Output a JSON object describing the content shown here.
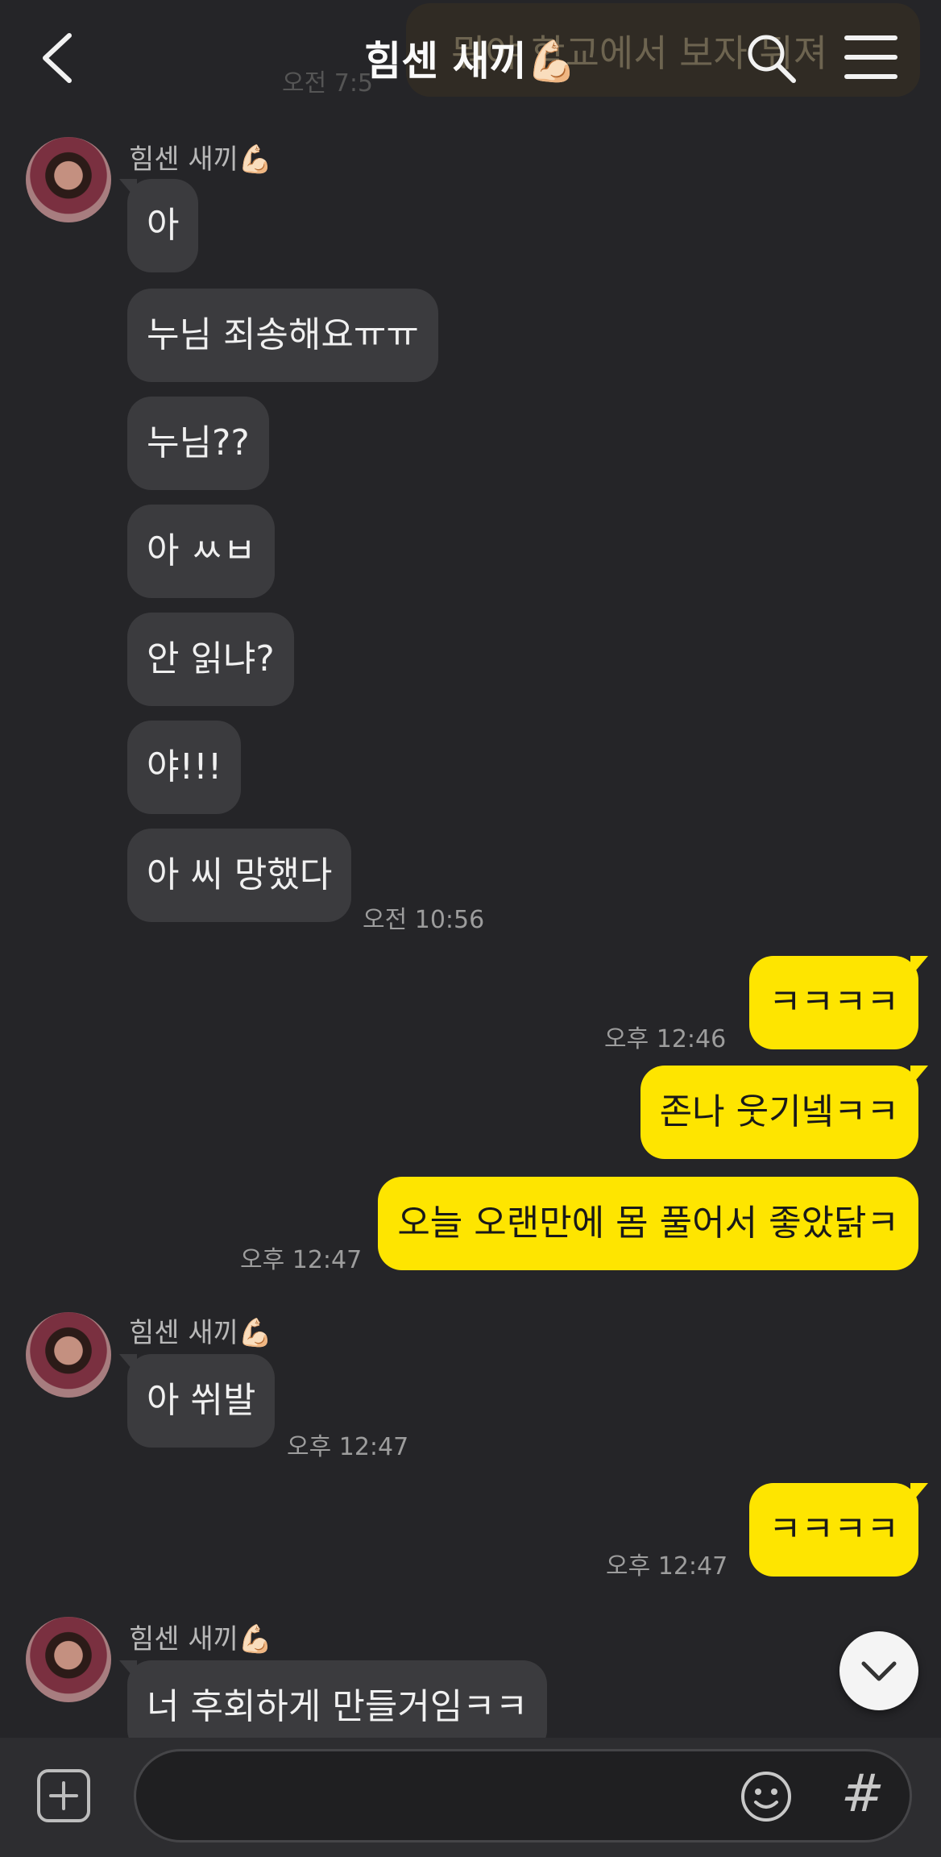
{
  "header": {
    "title": "힘센 새끼💪🏻",
    "ghost_message": "뭐야 학교에서 보자 뒤져",
    "ghost_time": "오전 7:5"
  },
  "messages": {
    "group1": {
      "sender": "힘센 새끼💪🏻",
      "bubbles": [
        "아",
        "누님 죄송해요ㅠㅠ",
        "누님??",
        "아 ㅆㅂ",
        "안 읽냐?",
        "야!!!",
        "아 씨 망했다"
      ],
      "time": "오전 10:56"
    },
    "sent1": {
      "text": "ㅋㅋㅋㅋ",
      "time": "오후 12:46"
    },
    "sent2": {
      "text": "존나 웃기넼ㅋㅋ"
    },
    "sent3": {
      "text": "오늘 오랜만에 몸 풀어서 좋았닭ㅋ",
      "time": "오후 12:47"
    },
    "group2": {
      "sender": "힘센 새끼💪🏻",
      "text": "아 쒸발",
      "time": "오후 12:47"
    },
    "sent4": {
      "text": "ㅋㅋㅋㅋ",
      "time": "오후 12:47"
    },
    "group3": {
      "sender": "힘센 새끼💪🏻",
      "text": "너 후회하게 만들거임ㅋㅋ"
    }
  },
  "bottom": {
    "input_value": "",
    "hash_label": "#"
  },
  "colors": {
    "background": "#252528",
    "received_bubble": "#3b3b3e",
    "sent_bubble": "#fee500"
  },
  "icons": [
    "back-arrow-icon",
    "search-icon",
    "menu-icon",
    "chevron-down-icon",
    "plus-icon",
    "emoji-icon"
  ]
}
